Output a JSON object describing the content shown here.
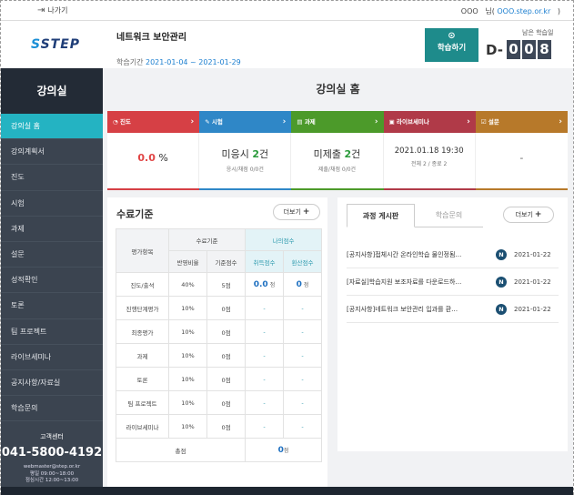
{
  "topbar": {
    "exit_label": "나가기",
    "user_name": "OOO",
    "user_suffix": "님(",
    "user_email": "OOO.step.or.kr",
    "user_close": ")"
  },
  "header": {
    "logo": "STEP",
    "course_title": "네트워크 보안관리",
    "period_label": "학습기간",
    "period_value": "2021-01-04 ~ 2021-01-29",
    "study_button": "학습하기",
    "remain_label": "남은 학습일",
    "dday_prefix": "D-",
    "dday_digits": [
      "0",
      "0",
      "8"
    ]
  },
  "sidebar": {
    "title": "강의실",
    "items": [
      "강의실 홈",
      "강의계획서",
      "진도",
      "시험",
      "과제",
      "설문",
      "성적확인",
      "토론",
      "팀 프로젝트",
      "라이브세미나",
      "공지사항/자료실",
      "학습문의"
    ],
    "active_index": 0,
    "contact": {
      "label": "고객센터",
      "phone": "041-5800-4192",
      "email": "webmaster@step.or.kr",
      "weekday": "평일 09:00~18:00",
      "lunch": "점심시간 12:00~13:00"
    }
  },
  "main": {
    "title": "강의실 홈",
    "cards": [
      {
        "label": "진도",
        "icon": "pie-chart-icon",
        "color": "#d64045",
        "value_red": "0.0",
        "value_rest": " %",
        "sub": ""
      },
      {
        "label": "시험",
        "icon": "pencil-icon",
        "color": "#2f87c7",
        "value_prefix": "미응시 ",
        "value_green": "2",
        "value_suffix": "건",
        "sub": "응시/채점 0/0건"
      },
      {
        "label": "과제",
        "icon": "document-icon",
        "color": "#4c9a2a",
        "value_prefix": "미제출 ",
        "value_green": "2",
        "value_suffix": "건",
        "sub": "제출/채점 0/0건"
      },
      {
        "label": "라이브세미나",
        "icon": "monitor-icon",
        "color": "#b03a48",
        "value_plain": "2021.01.18 19:30",
        "sub": "전체 2 / 종료 2"
      },
      {
        "label": "설문",
        "icon": "survey-icon",
        "color": "#b7792a",
        "value_plain": "-",
        "sub": ""
      }
    ],
    "criteria": {
      "title": "수료기준",
      "more": "더보기",
      "headers": {
        "item": "평가항목",
        "criteria": "수료기준",
        "mine": "나의점수",
        "ratio": "반영비율",
        "base": "기준점수",
        "earned": "취득점수",
        "converted": "환산점수"
      },
      "rows": [
        {
          "item": "진도/출석",
          "ratio": "40%",
          "base": "5점",
          "earned": "0.0",
          "earned_unit": "점",
          "converted": "0",
          "converted_unit": "점"
        },
        {
          "item": "진행단계평가",
          "ratio": "10%",
          "base": "0점",
          "earned": "-",
          "converted": "-"
        },
        {
          "item": "최종평가",
          "ratio": "10%",
          "base": "0점",
          "earned": "-",
          "converted": "-"
        },
        {
          "item": "과제",
          "ratio": "10%",
          "base": "0점",
          "earned": "-",
          "converted": "-"
        },
        {
          "item": "토론",
          "ratio": "10%",
          "base": "0점",
          "earned": "-",
          "converted": "-"
        },
        {
          "item": "팀 프로젝트",
          "ratio": "10%",
          "base": "0점",
          "earned": "-",
          "converted": "-"
        },
        {
          "item": "라이브세미나",
          "ratio": "10%",
          "base": "0점",
          "earned": "-",
          "converted": "-"
        }
      ],
      "total_label": "총점",
      "total_value": "0",
      "total_unit": "점"
    },
    "board": {
      "tabs": [
        "과정 게시판",
        "학습문의"
      ],
      "more": "더보기",
      "posts": [
        {
          "title": "[공지사항]접체시간 온라인학습 물인정됨…",
          "badge": "N",
          "date": "2021-01-22"
        },
        {
          "title": "[자료실]학습지원 보조자료를 다운로드하…",
          "badge": "N",
          "date": "2021-01-22"
        },
        {
          "title": "[공지사항]네트워크 보안관리 입과를 환…",
          "badge": "N",
          "date": "2021-01-22"
        }
      ]
    }
  }
}
